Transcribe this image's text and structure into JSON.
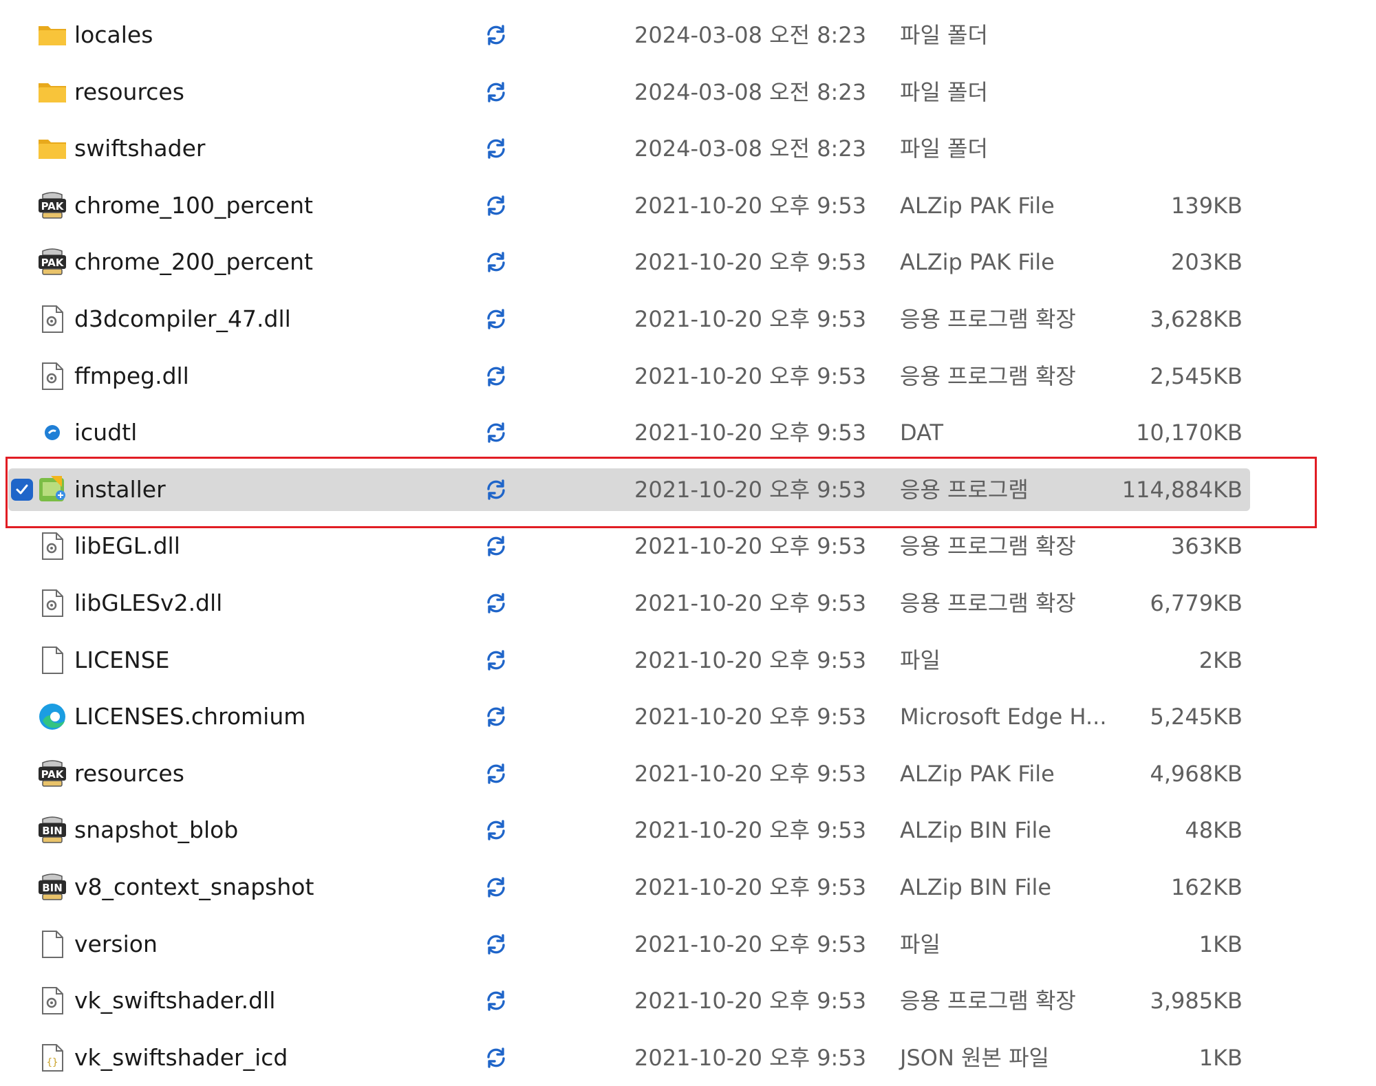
{
  "colors": {
    "folder": "#f8c43a",
    "sync_blue": "#1f65c9",
    "selection_bg": "#d9d9d9",
    "annotation_red": "#e11d24"
  },
  "files": [
    {
      "name": "locales",
      "icon": "folder-icon",
      "modified": "2024-03-08 오전 8:23",
      "type": "파일 폴더",
      "size": ""
    },
    {
      "name": "resources",
      "icon": "folder-icon",
      "modified": "2024-03-08 오전 8:23",
      "type": "파일 폴더",
      "size": ""
    },
    {
      "name": "swiftshader",
      "icon": "folder-icon",
      "modified": "2024-03-08 오전 8:23",
      "type": "파일 폴더",
      "size": ""
    },
    {
      "name": "chrome_100_percent",
      "icon": "pak-file-icon",
      "modified": "2021-10-20 오후 9:53",
      "type": "ALZip PAK File",
      "size": "139KB"
    },
    {
      "name": "chrome_200_percent",
      "icon": "pak-file-icon",
      "modified": "2021-10-20 오후 9:53",
      "type": "ALZip PAK File",
      "size": "203KB"
    },
    {
      "name": "d3dcompiler_47.dll",
      "icon": "dll-file-icon",
      "modified": "2021-10-20 오후 9:53",
      "type": "응용 프로그램 확장",
      "size": "3,628KB"
    },
    {
      "name": "ffmpeg.dll",
      "icon": "dll-file-icon",
      "modified": "2021-10-20 오후 9:53",
      "type": "응용 프로그램 확장",
      "size": "2,545KB"
    },
    {
      "name": "icudtl",
      "icon": "dat-file-icon",
      "modified": "2021-10-20 오후 9:53",
      "type": "DAT",
      "size": "10,170KB"
    },
    {
      "name": "installer",
      "icon": "installer-app-icon",
      "modified": "2021-10-20 오후 9:53",
      "type": "응용 프로그램",
      "size": "114,884KB",
      "selected": true
    },
    {
      "name": "libEGL.dll",
      "icon": "dll-file-icon",
      "modified": "2021-10-20 오후 9:53",
      "type": "응용 프로그램 확장",
      "size": "363KB"
    },
    {
      "name": "libGLESv2.dll",
      "icon": "dll-file-icon",
      "modified": "2021-10-20 오후 9:53",
      "type": "응용 프로그램 확장",
      "size": "6,779KB"
    },
    {
      "name": "LICENSE",
      "icon": "blank-file-icon",
      "modified": "2021-10-20 오후 9:53",
      "type": "파일",
      "size": "2KB"
    },
    {
      "name": "LICENSES.chromium",
      "icon": "edge-html-icon",
      "modified": "2021-10-20 오후 9:53",
      "type": "Microsoft Edge H...",
      "size": "5,245KB"
    },
    {
      "name": "resources",
      "icon": "pak-file-icon",
      "modified": "2021-10-20 오후 9:53",
      "type": "ALZip PAK File",
      "size": "4,968KB"
    },
    {
      "name": "snapshot_blob",
      "icon": "bin-file-icon",
      "modified": "2021-10-20 오후 9:53",
      "type": "ALZip BIN File",
      "size": "48KB"
    },
    {
      "name": "v8_context_snapshot",
      "icon": "bin-file-icon",
      "modified": "2021-10-20 오후 9:53",
      "type": "ALZip BIN File",
      "size": "162KB"
    },
    {
      "name": "version",
      "icon": "blank-file-icon",
      "modified": "2021-10-20 오후 9:53",
      "type": "파일",
      "size": "1KB"
    },
    {
      "name": "vk_swiftshader.dll",
      "icon": "dll-file-icon",
      "modified": "2021-10-20 오후 9:53",
      "type": "응용 프로그램 확장",
      "size": "3,985KB"
    },
    {
      "name": "vk_swiftshader_icd",
      "icon": "json-file-icon",
      "modified": "2021-10-20 오후 9:53",
      "type": "JSON 원본 파일",
      "size": "1KB"
    }
  ]
}
